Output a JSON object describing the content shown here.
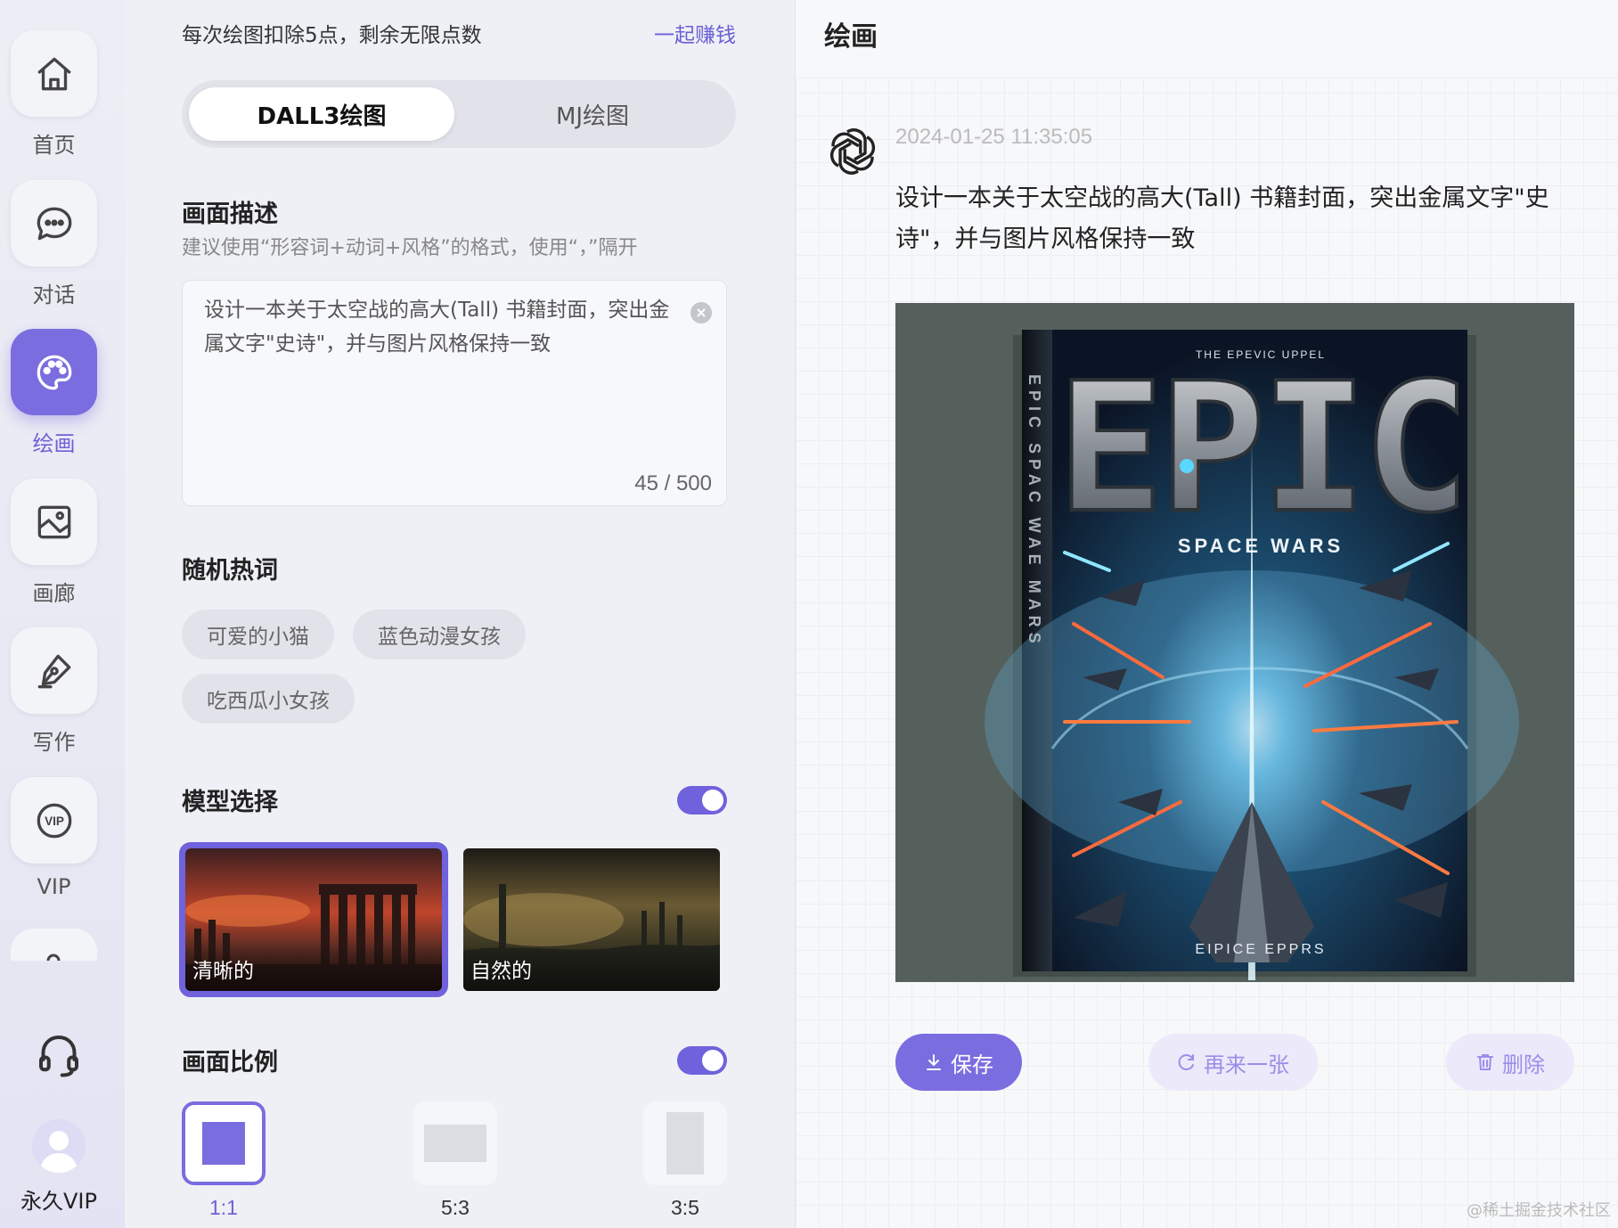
{
  "nav": {
    "items": [
      {
        "label": "首页",
        "icon": "home-icon"
      },
      {
        "label": "对话",
        "icon": "chat-icon"
      },
      {
        "label": "绘画",
        "icon": "palette-icon",
        "active": true
      },
      {
        "label": "画廊",
        "icon": "gallery-icon"
      },
      {
        "label": "写作",
        "icon": "pen-icon"
      },
      {
        "label": "VIP",
        "icon": "vip-icon"
      }
    ],
    "support_icon": "headset-icon",
    "user_label": "永久VIP"
  },
  "panel": {
    "points_text": "每次绘图扣除5点，剩余无限点数",
    "earn_link": "一起赚钱",
    "tabs": [
      {
        "label": "DALL3绘图",
        "active": true
      },
      {
        "label": "MJ绘图",
        "active": false
      }
    ],
    "description": {
      "title": "画面描述",
      "hint": "建议使用“形容词+动词+风格”的格式，使用“，”隔开",
      "value": "设计一本关于太空战的高大(Tall) 书籍封面，突出金属文字\"史诗\"，并与图片风格保持一致",
      "counter": "45 / 500"
    },
    "hot_words": {
      "title": "随机热词",
      "chips": [
        "可爱的小猫",
        "蓝色动漫女孩",
        "吃西瓜小女孩"
      ]
    },
    "model": {
      "title": "模型选择",
      "toggle_on": true,
      "options": [
        {
          "label": "清晰的",
          "selected": true
        },
        {
          "label": "自然的",
          "selected": false
        }
      ]
    },
    "ratio": {
      "title": "画面比例",
      "toggle_on": true,
      "options": [
        {
          "label": "1:1",
          "selected": true
        },
        {
          "label": "5:3",
          "selected": false
        },
        {
          "label": "3:5",
          "selected": false
        }
      ]
    }
  },
  "canvas": {
    "title": "绘画",
    "bot_icon": "openai-logo-icon",
    "timestamp": "2024-01-25 11:35:05",
    "message": "设计一本关于太空战的高大(Tall) 书籍封面，突出金属文字\"史诗\"，并与图片风格保持一致",
    "cover": {
      "top_text": "THE EPEVIC UPPEL",
      "title": "EPIC",
      "subtitle": "SPACE WARS",
      "bottom_text": "EIPICE EPPRS",
      "spine_text": "EPIC  SPAC WAE MARS"
    },
    "actions": {
      "save": "保存",
      "regenerate": "再来一张",
      "delete": "删除"
    },
    "watermark": "@稀土掘金技术社区"
  },
  "colors": {
    "accent": "#7a6de0",
    "accent_light": "#ece9fb"
  }
}
